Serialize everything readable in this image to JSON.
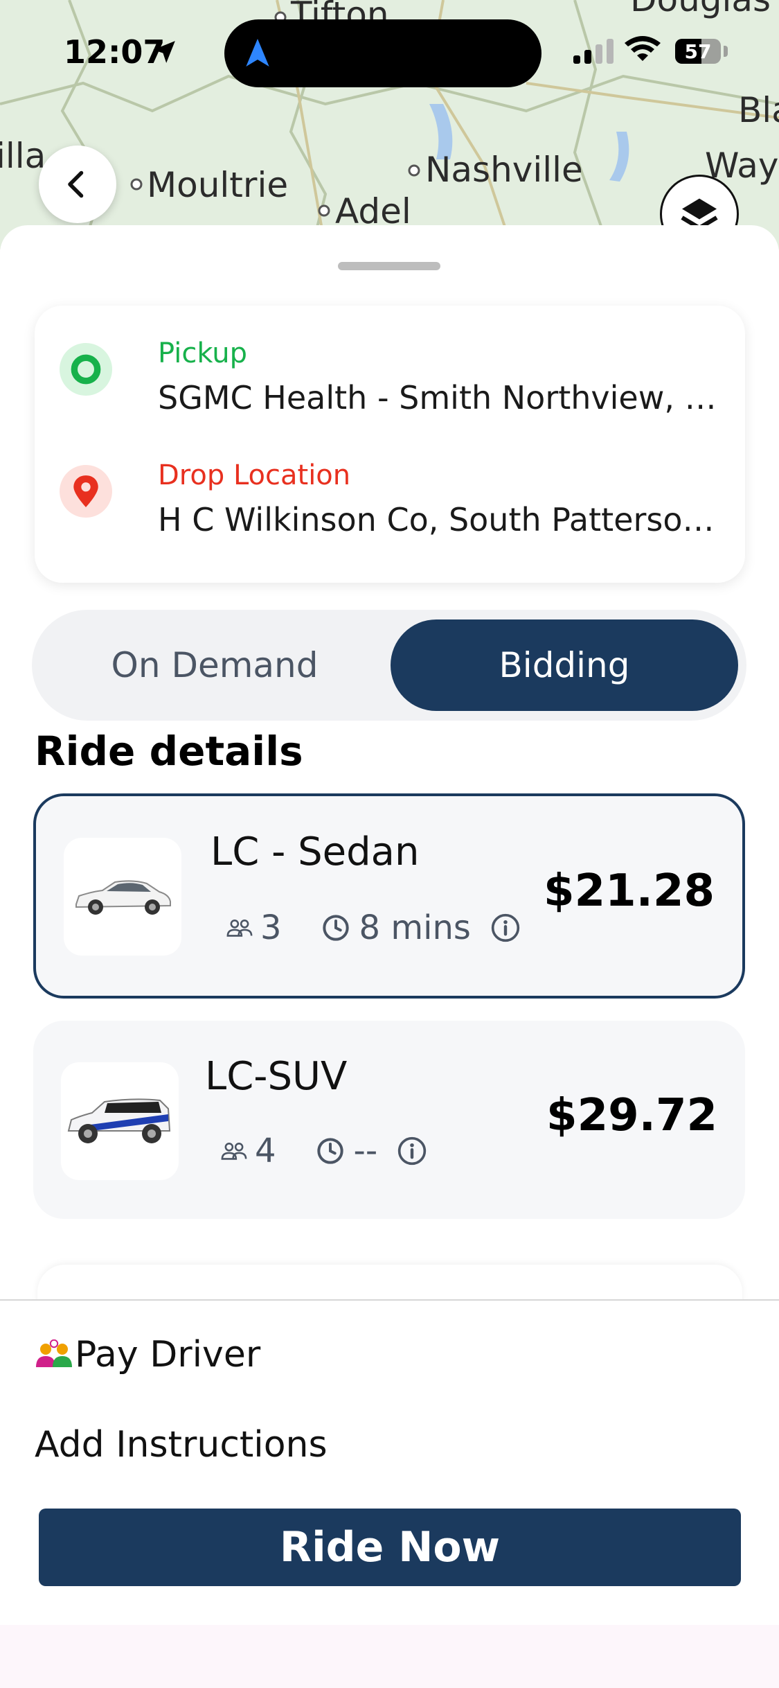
{
  "status_bar": {
    "time": "12:07",
    "battery_percent": "57",
    "battery_level": 0.57
  },
  "map": {
    "places": [
      "Tifton",
      "Douglas",
      "Moultrie",
      "Nashville",
      "Adel",
      "Bla",
      "Way",
      "illa"
    ]
  },
  "locations": {
    "pickup": {
      "label": "Pickup",
      "value": "SGMC Health - Smith Northview, Gornto Road, Valdosta, GA",
      "color": "#17b14b"
    },
    "drop": {
      "label": "Drop Location",
      "value": "H C Wilkinson Co, South Patterson Street, Valdosta, GA",
      "color": "#e8301f"
    }
  },
  "mode_toggle": {
    "options": [
      "On Demand",
      "Bidding"
    ],
    "selected": "Bidding"
  },
  "ride_details": {
    "title": "Ride details",
    "rides": [
      {
        "name": "LC - Sedan",
        "seats": "3",
        "eta": "8 mins",
        "price": "$21.28",
        "selected": true
      },
      {
        "name": "LC-SUV",
        "seats": "4",
        "eta": "--",
        "price": "$29.72",
        "selected": false
      }
    ]
  },
  "footer": {
    "pay_label": "Pay Driver",
    "instructions_label": "Add Instructions",
    "cta_label": "Ride Now"
  },
  "colors": {
    "primary": "#1b3a5e",
    "pickup": "#17b14b",
    "drop": "#e8301f"
  }
}
